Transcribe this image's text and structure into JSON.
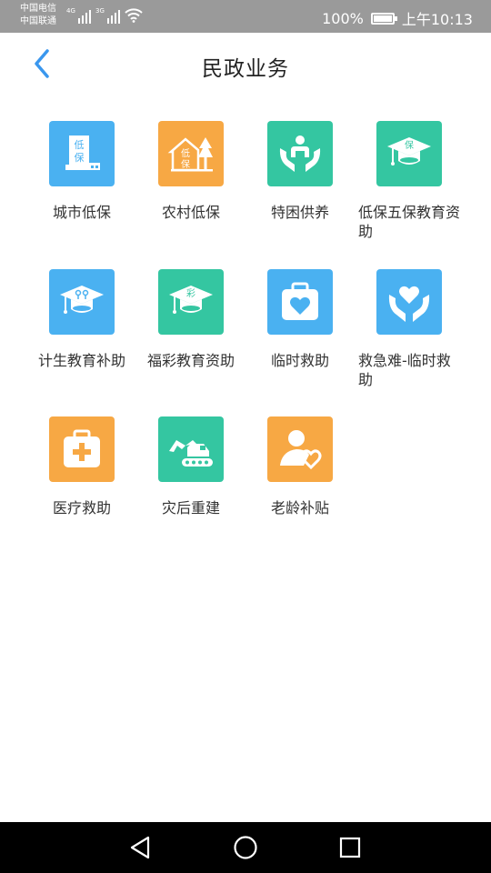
{
  "status_bar": {
    "carrier_1": "中国电信",
    "carrier_2": "中国联通",
    "signal_1_tag": "4G",
    "signal_2_tag": "3G",
    "battery_percent": "100%",
    "time": "上午10:13"
  },
  "header": {
    "title": "民政业务"
  },
  "colors": {
    "blue": "#4ab1f1",
    "orange": "#f7a844",
    "teal": "#34c6a1",
    "back_arrow": "#3a97ee"
  },
  "services": [
    {
      "label": "城市低保",
      "icon": "city-low-income-icon",
      "color": "blue"
    },
    {
      "label": "农村低保",
      "icon": "rural-low-income-icon",
      "color": "orange"
    },
    {
      "label": "特困供养",
      "icon": "special-support-icon",
      "color": "teal"
    },
    {
      "label": "低保五保教育资助",
      "icon": "education-aid-cap-icon",
      "color": "teal"
    },
    {
      "label": "计生教育补助",
      "icon": "family-planning-cap-icon",
      "color": "blue"
    },
    {
      "label": "福彩教育资助",
      "icon": "lottery-cap-icon",
      "color": "teal"
    },
    {
      "label": "临时救助",
      "icon": "heart-kit-icon",
      "color": "blue"
    },
    {
      "label": "救急难-临时救助",
      "icon": "hands-heart-icon",
      "color": "blue"
    },
    {
      "label": "医疗救助",
      "icon": "medical-kit-icon",
      "color": "orange"
    },
    {
      "label": "灾后重建",
      "icon": "excavator-icon",
      "color": "teal"
    },
    {
      "label": "老龄补贴",
      "icon": "elderly-care-icon",
      "color": "orange"
    }
  ],
  "icon_text": {
    "low": "低",
    "bao": "保",
    "cai": "彩"
  }
}
